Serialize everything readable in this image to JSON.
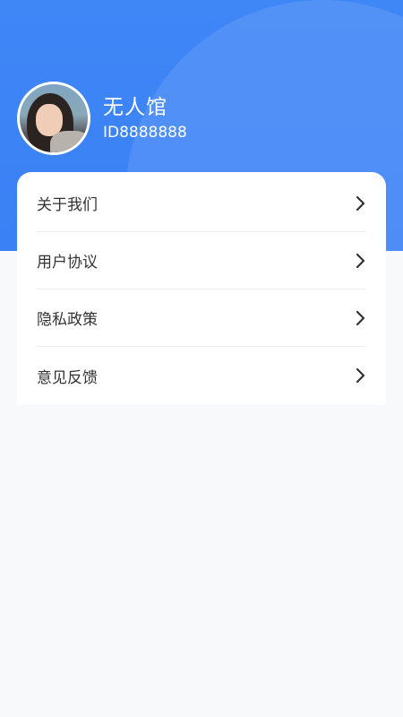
{
  "profile": {
    "name": "无人馆",
    "id_text": "ID8888888"
  },
  "menu": [
    {
      "label": "关于我们",
      "icon": "chevron-right-icon"
    },
    {
      "label": "用户协议",
      "icon": "chevron-right-icon"
    },
    {
      "label": "隐私政策",
      "icon": "chevron-right-icon"
    },
    {
      "label": "意见反馈",
      "icon": "chevron-right-icon"
    }
  ],
  "colors": {
    "header": "#3a81f5",
    "background": "#f7f9fb",
    "text": "#333333"
  }
}
